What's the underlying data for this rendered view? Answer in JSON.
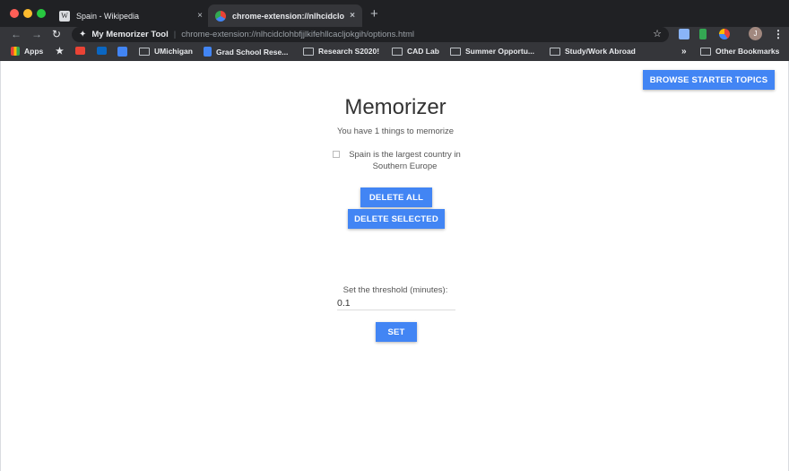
{
  "browser": {
    "tabs": [
      {
        "title": "Spain - Wikipedia",
        "close": "×"
      },
      {
        "title": "chrome-extension://nlhcidclohbfjjlkifehllcacljokgih/options.html",
        "close": "×"
      }
    ],
    "new_tab": "+",
    "omnibox": {
      "site_name": "My Memorizer Tool",
      "separator": "|",
      "url": "chrome-extension://nlhcidclohbfjjlkifehllcacljokgih/options.html"
    },
    "avatar_initial": "J",
    "bookmarks": [
      "Apps",
      "UMichigan",
      "Grad School Rese...",
      "Research S2020!",
      "CAD Lab",
      "Summer Opportu...",
      "Study/Work Abroad"
    ],
    "bookmarks_more": "»",
    "other_bookmarks": "Other Bookmarks"
  },
  "page": {
    "browse_button": "BROWSE STARTER TOPICS",
    "title": "Memorizer",
    "subtitle": "You have 1 things to memorize",
    "items": [
      "Spain is the largest country in Southern Europe"
    ],
    "delete_all": "DELETE ALL",
    "delete_selected": "DELETE SELECTED",
    "threshold_label": "Set the threshold (minutes):",
    "threshold_value": "0.1",
    "set_button": "SET"
  },
  "colors": {
    "accent": "#4285f4",
    "chrome_dark": "#35363a",
    "tabstrip": "#202124"
  }
}
